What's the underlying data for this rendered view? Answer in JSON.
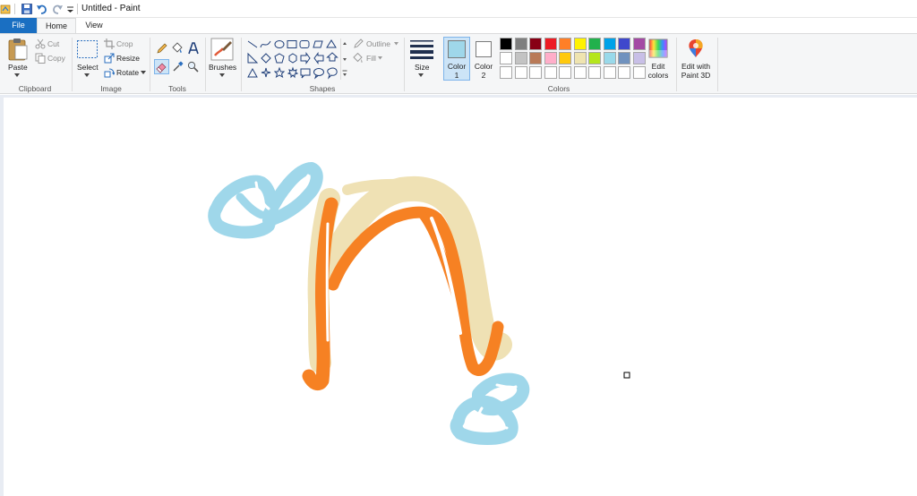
{
  "window": {
    "title": "Untitled - Paint"
  },
  "tabs": {
    "file": "File",
    "home": "Home",
    "view": "View"
  },
  "clipboard": {
    "paste": "Paste",
    "cut": "Cut",
    "copy": "Copy",
    "group": "Clipboard"
  },
  "image": {
    "select": "Select",
    "crop": "Crop",
    "resize": "Resize",
    "rotate": "Rotate",
    "group": "Image"
  },
  "tools": {
    "group": "Tools"
  },
  "brushes": {
    "label": "Brushes"
  },
  "shapes": {
    "outline": "Outline",
    "fill": "Fill",
    "group": "Shapes"
  },
  "size": {
    "label": "Size"
  },
  "colors": {
    "color1_line1": "Color",
    "color1_line2": "1",
    "color2_line1": "Color",
    "color2_line2": "2",
    "color1_value": "#9fd7ea",
    "color2_value": "#ffffff",
    "edit_line1": "Edit",
    "edit_line2": "colors",
    "group": "Colors",
    "palette_row1": [
      "#000000",
      "#7f7f7f",
      "#880015",
      "#ed1c24",
      "#ff7f27",
      "#fff200",
      "#22b14c",
      "#00a2e8",
      "#3f48cc",
      "#a349a4"
    ],
    "palette_row2": [
      "#ffffff",
      "#c3c3c3",
      "#b97a57",
      "#ffaec9",
      "#ffc90e",
      "#efe4b0",
      "#b5e61d",
      "#99d9ea",
      "#7092be",
      "#c8bfe7"
    ],
    "palette_row3": [
      "#ffffff",
      "#ffffff",
      "#ffffff",
      "#ffffff",
      "#ffffff",
      "#ffffff",
      "#ffffff",
      "#ffffff",
      "#ffffff",
      "#ffffff"
    ]
  },
  "paint3d": {
    "line1": "Edit with",
    "line2": "Paint 3D"
  },
  "drawing_colors": {
    "cream": "#efe1b4",
    "orange": "#f68123",
    "light_blue": "#9fd7ea"
  }
}
